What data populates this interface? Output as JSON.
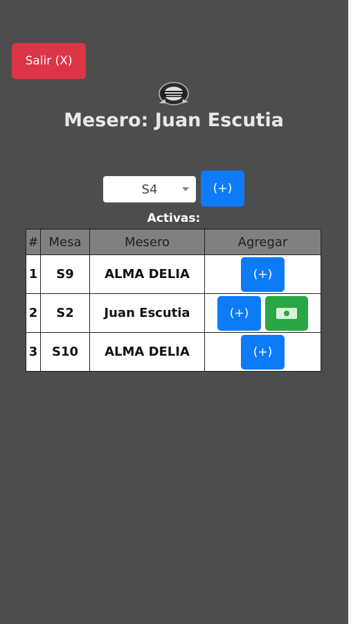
{
  "header": {
    "logout_label": "Salir (X)",
    "title": "Mesero: Juan Escutia"
  },
  "controls": {
    "selected_table": "S4",
    "add_label": "(+)"
  },
  "section_label": "Activas:",
  "table": {
    "columns": [
      "#",
      "Mesa",
      "Mesero",
      "Agregar"
    ],
    "rows": [
      {
        "num": "1",
        "mesa": "S9",
        "mesero": "ALMA DELIA",
        "add_label": "(+)",
        "has_pay": false
      },
      {
        "num": "2",
        "mesa": "S2",
        "mesero": "Juan Escutia",
        "add_label": "(+)",
        "has_pay": true
      },
      {
        "num": "3",
        "mesa": "S10",
        "mesero": "ALMA DELIA",
        "add_label": "(+)",
        "has_pay": false
      }
    ]
  },
  "icons": {
    "logo": "restaurant-logo",
    "pay": "cash-icon",
    "dropdown": "chevron-down-icon"
  },
  "colors": {
    "background": "#4d4d4d",
    "danger": "#dc3545",
    "primary": "#0d7bf7",
    "success": "#28a745"
  }
}
